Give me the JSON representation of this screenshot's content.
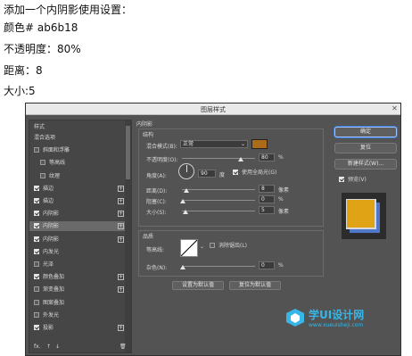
{
  "instructions": [
    "添加一个内阴影使用设置：",
    "颜色# ab6b18",
    "不透明度：80%",
    "距离：8",
    "大小:5"
  ],
  "dialog": {
    "title": "图层样式",
    "close": "✕",
    "styles": {
      "header": "样式",
      "items": [
        {
          "label": "混合选项",
          "checkbox": false,
          "checked": false,
          "sub": false,
          "plus": false,
          "selected": false
        },
        {
          "label": "斜面和浮雕",
          "checkbox": true,
          "checked": false,
          "sub": false,
          "plus": false,
          "selected": false
        },
        {
          "label": "等高线",
          "checkbox": true,
          "checked": false,
          "sub": true,
          "plus": false,
          "selected": false
        },
        {
          "label": "纹理",
          "checkbox": true,
          "checked": false,
          "sub": true,
          "plus": false,
          "selected": false
        },
        {
          "label": "描边",
          "checkbox": true,
          "checked": true,
          "sub": false,
          "plus": true,
          "selected": false
        },
        {
          "label": "描边",
          "checkbox": true,
          "checked": true,
          "sub": false,
          "plus": true,
          "selected": false
        },
        {
          "label": "内阴影",
          "checkbox": true,
          "checked": true,
          "sub": false,
          "plus": true,
          "selected": false
        },
        {
          "label": "内阴影",
          "checkbox": true,
          "checked": true,
          "sub": false,
          "plus": true,
          "selected": true
        },
        {
          "label": "内阴影",
          "checkbox": true,
          "checked": true,
          "sub": false,
          "plus": true,
          "selected": false
        },
        {
          "label": "内发光",
          "checkbox": true,
          "checked": true,
          "sub": false,
          "plus": false,
          "selected": false
        },
        {
          "label": "光泽",
          "checkbox": true,
          "checked": false,
          "sub": false,
          "plus": false,
          "selected": false
        },
        {
          "label": "颜色叠加",
          "checkbox": true,
          "checked": true,
          "sub": false,
          "plus": true,
          "selected": false
        },
        {
          "label": "渐变叠加",
          "checkbox": true,
          "checked": false,
          "sub": false,
          "plus": true,
          "selected": false
        },
        {
          "label": "图案叠加",
          "checkbox": true,
          "checked": false,
          "sub": false,
          "plus": false,
          "selected": false
        },
        {
          "label": "外发光",
          "checkbox": true,
          "checked": false,
          "sub": false,
          "plus": false,
          "selected": false
        },
        {
          "label": "投影",
          "checkbox": true,
          "checked": true,
          "sub": false,
          "plus": true,
          "selected": false
        }
      ],
      "footer": [
        "fx.",
        "↑",
        "↓",
        "🗑"
      ]
    },
    "inner_shadow": {
      "section": "内阴影",
      "structure": "结构",
      "blend_mode_label": "混合模式(B):",
      "blend_mode_value": "正常",
      "color": "#ab6b18",
      "opacity_label": "不透明度(O):",
      "opacity_value": "80",
      "opacity_level": 0.8,
      "angle_label": "角度(A):",
      "angle_value": "90",
      "angle_unit": "度",
      "global_light_label": "使用全局光(G)",
      "distance_label": "距离(D):",
      "distance_value": "8",
      "distance_unit": "像素",
      "choke_label": "阻塞(C):",
      "choke_value": "0",
      "choke_unit": "%",
      "size_label": "大小(S):",
      "size_value": "5",
      "size_unit": "像素",
      "quality": "品质",
      "contour_label": "等高线:",
      "antialias_label": "消除锯齿(L)",
      "noise_label": "杂色(N):",
      "noise_value": "0",
      "noise_unit": "%",
      "percent": "%",
      "btn_default": "设置为默认值",
      "btn_reset": "复位为默认值"
    },
    "right": {
      "ok": "确定",
      "reset": "复位",
      "new_style": "新建样式(W)...",
      "preview_label": "预览(V)"
    }
  },
  "watermark": {
    "text": "学UI设计网",
    "url": "www.xueuisheji.com",
    "color": "#37b6e8"
  }
}
